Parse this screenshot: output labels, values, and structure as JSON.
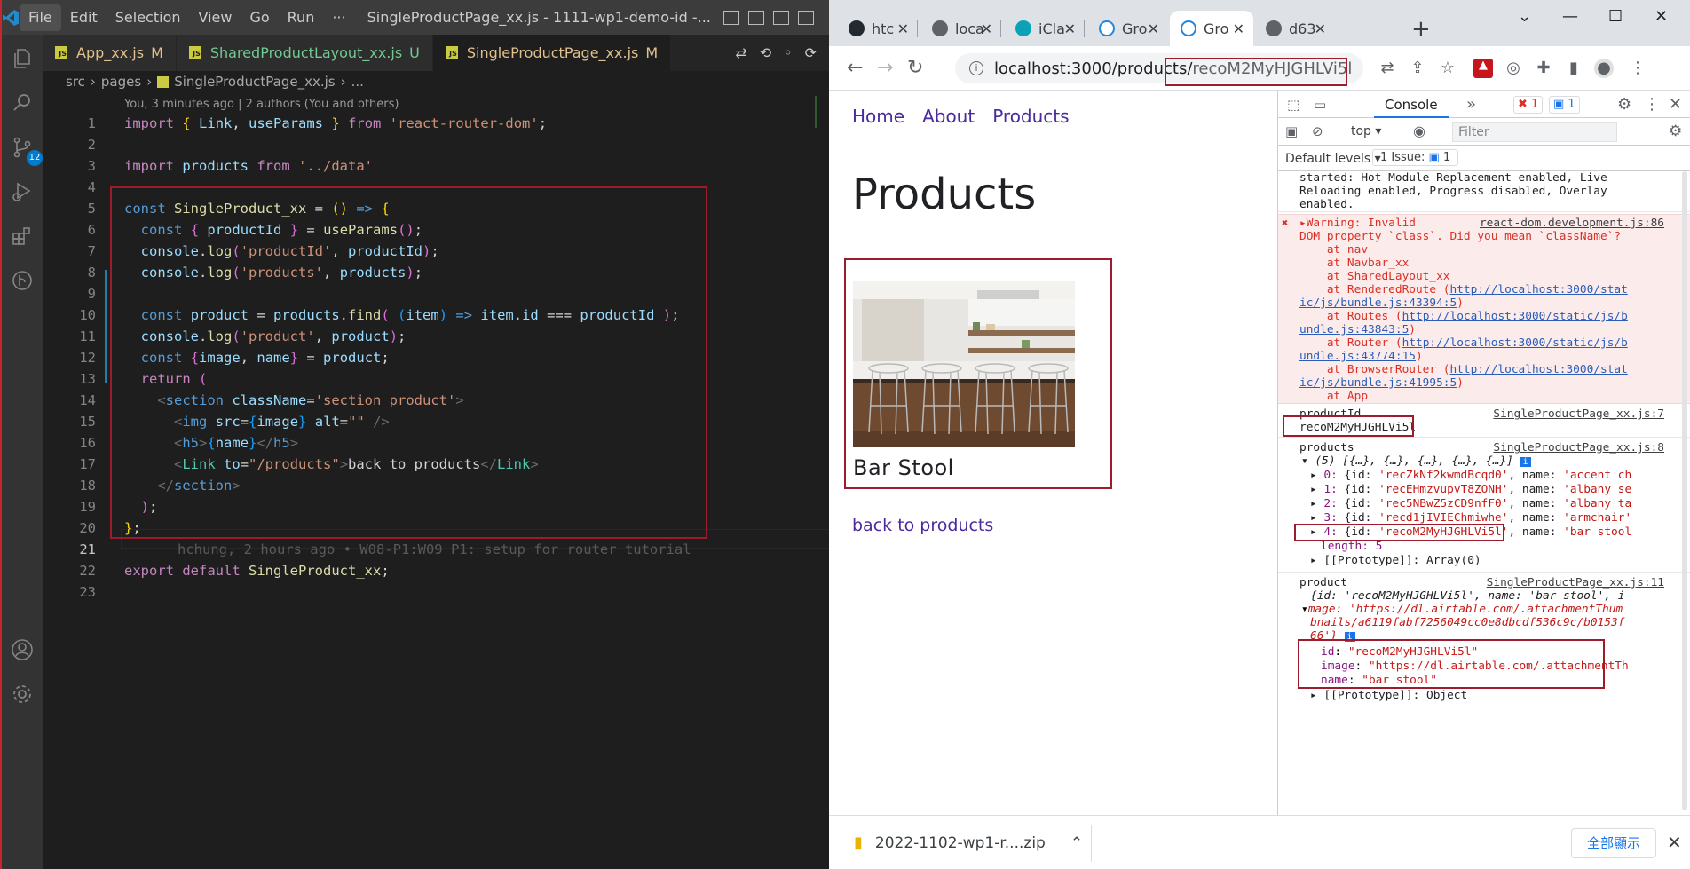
{
  "vscode": {
    "menus": [
      "File",
      "Edit",
      "Selection",
      "View",
      "Go",
      "Run",
      "···"
    ],
    "window_title": "SingleProductPage_xx.js - 1111-wp1-demo-id -...",
    "scm_badge": "12",
    "tabs": [
      {
        "label": "App_xx.js",
        "status": "M"
      },
      {
        "label": "SharedProductLayout_xx.js",
        "status": "U"
      },
      {
        "label": "SingleProductPage_xx.js",
        "status": "M"
      }
    ],
    "breadcrumb": [
      "src",
      "pages",
      "SingleProductPage_xx.js",
      "..."
    ],
    "codelens": "You, 3 minutes ago | 2 authors (You and others)",
    "blame_line": "hchung, 2 hours ago • W08-P1:W09_P1: setup for router tutorial",
    "line_numbers": [
      "1",
      "2",
      "3",
      "4",
      "5",
      "6",
      "7",
      "8",
      "9",
      "10",
      "11",
      "12",
      "13",
      "14",
      "15",
      "16",
      "17",
      "18",
      "19",
      "20",
      "21",
      "22",
      "23"
    ]
  },
  "browser": {
    "tabs": [
      "htc",
      "loca",
      "iCla",
      "Gro",
      "Gro",
      "d63"
    ],
    "url_host": "localhost:3000/products/",
    "url_path": "recoM2MyHJGHLVi5l",
    "page": {
      "nav": [
        "Home",
        "About",
        "Products"
      ],
      "title": "Products",
      "product_name": "Bar Stool",
      "back_link": "back to products"
    },
    "devtools": {
      "tab": "Console",
      "error_count": "1",
      "info_count": "1",
      "context": "top",
      "filter_placeholder": "Filter",
      "levels": "Default levels",
      "issues": "1 Issue:",
      "issues_count": "1",
      "log_started": "started: Hot Module Replacement enabled, Live\nReloading enabled, Progress disabled, Overlay\nenabled.",
      "warning_head": "Warning: Invalid",
      "warning_src": "react-dom.development.js:86",
      "warning_body": "DOM property `class`. Did you mean `className`?\n    at nav\n    at Navbar_xx\n    at SharedLayout_xx",
      "stack": [
        {
          "pre": "    at RenderedRoute (",
          "url": "http://localhost:3000/stat",
          "url2": "ic/js/bundle.js:43394:5",
          "post": ")"
        },
        {
          "pre": "    at Routes (",
          "url": "http://localhost:3000/static/js/b",
          "url2": "undle.js:43843:5",
          "post": ")"
        },
        {
          "pre": "    at Router (",
          "url": "http://localhost:3000/static/js/b",
          "url2": "undle.js:43774:15",
          "post": ")"
        },
        {
          "pre": "    at BrowserRouter (",
          "url": "http://localhost:3000/stat",
          "url2": "ic/js/bundle.js:41995:5",
          "post": ")"
        }
      ],
      "stack_last": "    at App",
      "productId_label": "productId",
      "productId_src": "SingleProductPage_xx.js:7",
      "productId_value": "recoM2MyHJGHLVi5l",
      "products_label": "products",
      "products_src": "SingleProductPage_xx.js:8",
      "products_summary": "(5) [{…}, {…}, {…}, {…}, {…}]",
      "products_items": [
        {
          "idx": "0:",
          "id": "'recZkNf2kwmdBcqd0'",
          "name": "'accent ch"
        },
        {
          "idx": "1:",
          "id": "'recEHmzvupvT8ZONH'",
          "name": "'albany se"
        },
        {
          "idx": "2:",
          "id": "'rec5NBwZ5zCD9nfF0'",
          "name": "'albany ta"
        },
        {
          "idx": "3:",
          "id": "'recd1jIVIEChmiwhe'",
          "name": "'armchair'"
        },
        {
          "idx": "4:",
          "id": "'recoM2MyHJGHLVi5l'",
          "name": "'bar stool"
        }
      ],
      "products_length": "length: 5",
      "products_proto": "[[Prototype]]: Array(0)",
      "product_label": "product",
      "product_src": "SingleProductPage_xx.js:11",
      "product_summary_1": "{id: 'recoM2MyHJGHLVi5l', name: 'bar stool', i",
      "product_summary_2": "mage: 'https://dl.airtable.com/.attachmentThum",
      "product_summary_3": "bnails/a6119fabf7256049cc0e8dbcdf536c9c/b0153f",
      "product_summary_4": "66'}",
      "product_id": "\"recoM2MyHJGHLVi5l\"",
      "product_image": "\"https://dl.airtable.com/.attachmentTh",
      "product_name": "\"bar stool\"",
      "product_proto": "[[Prototype]]: Object"
    },
    "download": {
      "file": "2022-1102-wp1-r....zip",
      "show_all": "全部顯示"
    }
  }
}
